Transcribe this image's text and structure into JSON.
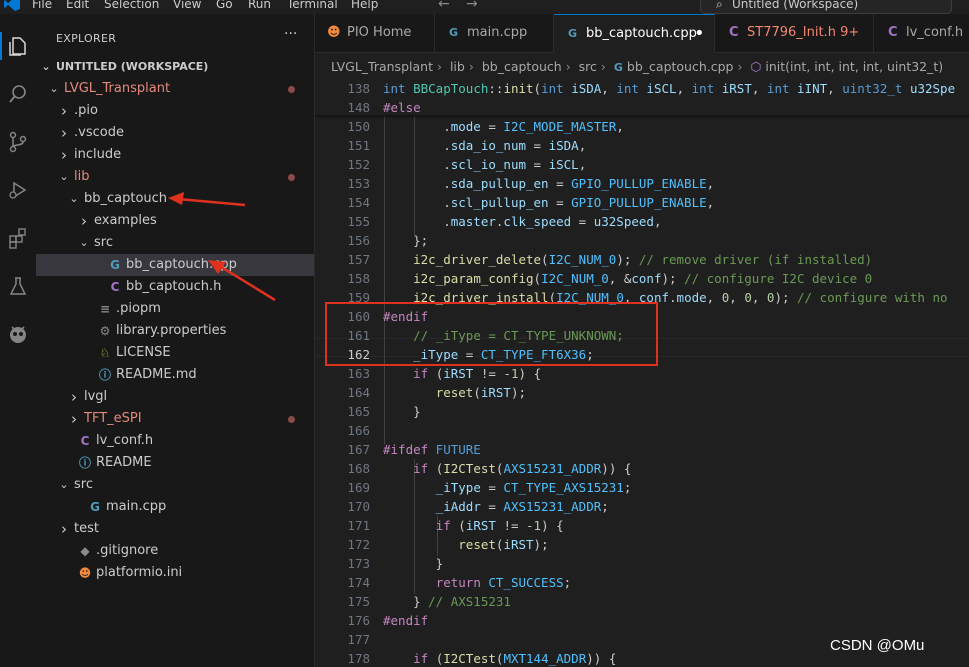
{
  "menu": [
    "File",
    "Edit",
    "Selection",
    "View",
    "Go",
    "Run",
    "Terminal",
    "Help"
  ],
  "window_title": "Untitled (Workspace)",
  "sidebar": {
    "header": "EXPLORER",
    "workspace": "UNTITLED (WORKSPACE)",
    "items": [
      {
        "label": "LVGL_Transplant",
        "icon": "chevron-down",
        "color": "#e38a7e",
        "modified": true
      },
      {
        "label": ".pio",
        "icon": "chevron-right",
        "color": "#cccccc"
      },
      {
        "label": ".vscode",
        "icon": "chevron-right",
        "color": "#cccccc"
      },
      {
        "label": "include",
        "icon": "chevron-right",
        "color": "#cccccc"
      },
      {
        "label": "lib",
        "icon": "chevron-down",
        "color": "#e38a7e",
        "modified": true
      },
      {
        "label": "bb_captouch",
        "icon": "chevron-down",
        "color": "#cccccc"
      },
      {
        "label": "examples",
        "icon": "chevron-right",
        "color": "#cccccc"
      },
      {
        "label": "src",
        "icon": "chevron-down",
        "color": "#cccccc"
      },
      {
        "label": "bb_captouch.cpp",
        "icon": "cpp-file-icon",
        "color": "#cccccc",
        "selected": true
      },
      {
        "label": "bb_captouch.h",
        "icon": "c-header-icon",
        "color": "#cccccc"
      },
      {
        "label": ".piopm",
        "icon": "file-icon",
        "color": "#cccccc"
      },
      {
        "label": "library.properties",
        "icon": "gear-icon",
        "color": "#cccccc"
      },
      {
        "label": "LICENSE",
        "icon": "license-icon",
        "color": "#cccccc"
      },
      {
        "label": "README.md",
        "icon": "info-icon",
        "color": "#cccccc"
      },
      {
        "label": "lvgl",
        "icon": "chevron-right",
        "color": "#cccccc"
      },
      {
        "label": "TFT_eSPI",
        "icon": "chevron-right",
        "color": "#e38a7e",
        "modified": true
      },
      {
        "label": "lv_conf.h",
        "icon": "c-header-icon",
        "color": "#cccccc"
      },
      {
        "label": "README",
        "icon": "info-icon",
        "color": "#cccccc"
      },
      {
        "label": "src",
        "icon": "chevron-down",
        "color": "#cccccc"
      },
      {
        "label": "main.cpp",
        "icon": "cpp-file-icon",
        "color": "#cccccc"
      },
      {
        "label": "test",
        "icon": "chevron-right",
        "color": "#cccccc"
      },
      {
        "label": ".gitignore",
        "icon": "git-icon",
        "color": "#cccccc"
      },
      {
        "label": "platformio.ini",
        "icon": "platformio-icon",
        "color": "#cccccc"
      }
    ]
  },
  "tabs": [
    {
      "label": "PIO Home",
      "icon": "platformio-icon"
    },
    {
      "label": "main.cpp",
      "icon": "cpp-file-icon"
    },
    {
      "label": "bb_captouch.cpp",
      "icon": "cpp-file-icon",
      "active": true,
      "dirty": true
    },
    {
      "label": "ST7796_Init.h 9+",
      "icon": "c-header-icon",
      "error": true
    },
    {
      "label": "lv_conf.h",
      "icon": "c-header-icon"
    }
  ],
  "breadcrumbs": [
    "LVGL_Transplant",
    "lib",
    "bb_captouch",
    "src",
    "bb_captouch.cpp",
    "init(int, int, int, int, uint32_t)"
  ],
  "editor": {
    "current_line": "162",
    "lines": [
      {
        "n": "138",
        "text": "int BBCapTouch::init(int iSDA, int iSCL, int iRST, int iINT, uint32_t u32Spe"
      },
      {
        "n": "148",
        "text": "#else"
      },
      {
        "n": "150",
        "text": "        .mode = I2C_MODE_MASTER,"
      },
      {
        "n": "151",
        "text": "        .sda_io_num = iSDA,"
      },
      {
        "n": "152",
        "text": "        .scl_io_num = iSCL,"
      },
      {
        "n": "153",
        "text": "        .sda_pullup_en = GPIO_PULLUP_ENABLE,"
      },
      {
        "n": "154",
        "text": "        .scl_pullup_en = GPIO_PULLUP_ENABLE,"
      },
      {
        "n": "155",
        "text": "        .master.clk_speed = u32Speed,"
      },
      {
        "n": "156",
        "text": "    };"
      },
      {
        "n": "157",
        "text": "    i2c_driver_delete(I2C_NUM_0); // remove driver (if installed)"
      },
      {
        "n": "158",
        "text": "    i2c_param_config(I2C_NUM_0, &conf); // configure I2C device 0"
      },
      {
        "n": "159",
        "text": "    i2c_driver_install(I2C_NUM_0, conf.mode, 0, 0, 0); // configure with no"
      },
      {
        "n": "160",
        "text": "#endif"
      },
      {
        "n": "161",
        "text": "    // _iType = CT_TYPE_UNKNOWN;"
      },
      {
        "n": "162",
        "text": "    _iType = CT_TYPE_FT6X36;"
      },
      {
        "n": "163",
        "text": "    if (iRST != -1) {"
      },
      {
        "n": "164",
        "text": "       reset(iRST);"
      },
      {
        "n": "165",
        "text": "    }"
      },
      {
        "n": "166",
        "text": ""
      },
      {
        "n": "167",
        "text": "#ifdef FUTURE"
      },
      {
        "n": "168",
        "text": "    if (I2CTest(AXS15231_ADDR)) {"
      },
      {
        "n": "169",
        "text": "       _iType = CT_TYPE_AXS15231;"
      },
      {
        "n": "170",
        "text": "       _iAddr = AXS15231_ADDR;"
      },
      {
        "n": "171",
        "text": "       if (iRST != -1) {"
      },
      {
        "n": "172",
        "text": "          reset(iRST);"
      },
      {
        "n": "173",
        "text": "       }"
      },
      {
        "n": "174",
        "text": "       return CT_SUCCESS;"
      },
      {
        "n": "175",
        "text": "    } // AXS15231"
      },
      {
        "n": "176",
        "text": "#endif"
      },
      {
        "n": "177",
        "text": ""
      },
      {
        "n": "178",
        "text": "    if (I2CTest(MXT144_ADDR)) {"
      }
    ]
  },
  "watermark": "CSDN @OMu",
  "colors": {
    "accent": "#0078d4",
    "annotation": "#e0301e",
    "modified_folder": "#e38a7e"
  }
}
